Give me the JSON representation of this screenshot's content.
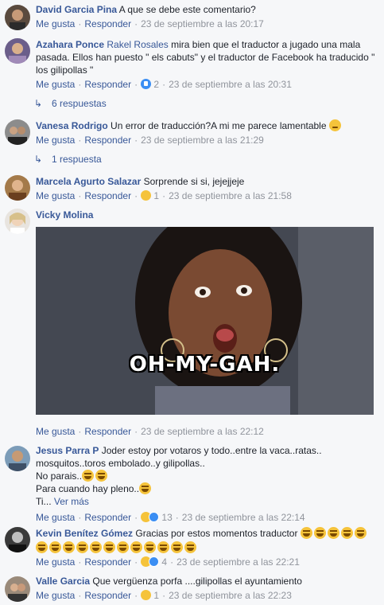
{
  "actions": {
    "like": "Me gusta",
    "reply": "Responder"
  },
  "comments": [
    {
      "author": "David Garcia Pina",
      "text": "A que se debe este comentario?",
      "timestamp": "23 de septiembre a las 20:17"
    },
    {
      "author": "Azahara Ponce",
      "mention": "Rakel Rosales",
      "text": " mira bien que el traductor a jugado una mala pasada. Ellos han puesto \" els cabuts\" y el traductor de Facebook ha traducido \" los gilipollas \"",
      "reactions_count": "2",
      "timestamp": "23 de septiembre a las 20:31",
      "replies": "6 respuestas"
    },
    {
      "author": "Vanesa Rodrigo",
      "text": "Un error de traducción?A mi me parece lamentable",
      "timestamp": "23 de septiembre a las 21:29",
      "replies": "1 respuesta"
    },
    {
      "author": "Marcela Agurto Salazar",
      "text": "Sorprende si si, jejejjeje",
      "reactions_count": "1",
      "timestamp": "23 de septiembre a las 21:58"
    },
    {
      "author": "Vicky Molina",
      "gif_caption": "OH-MY-GAH.",
      "timestamp": "23 de septiembre a las 22:12"
    },
    {
      "author": "Jesus Parra P",
      "text_line1": "Joder estoy por votaros y todo..entre la vaca..ratas..",
      "text_line2": "mosquitos..toros embolado..y gilipollas..",
      "text_line3": "No parais..",
      "text_line4": "Para cuando hay pleno..",
      "text_line5": "Ti...",
      "see_more": "Ver más",
      "reactions_count": "13",
      "timestamp": "23 de septiembre a las 22:14"
    },
    {
      "author": "Kevin Benítez Gómez",
      "text": "Gracias por estos momentos traductor",
      "reactions_count": "4",
      "timestamp": "23 de septiembre a las 22:21"
    },
    {
      "author": "Valle Garcia",
      "text": "Que vergüenza porfa ....gilipollas el ayuntamiento",
      "reactions_count": "1",
      "timestamp": "23 de septiembre a las 22:23"
    }
  ]
}
